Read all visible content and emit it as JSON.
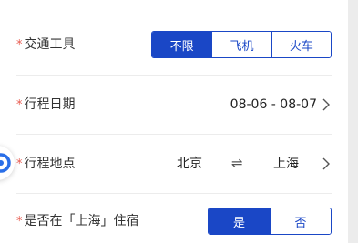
{
  "transport": {
    "label": "交通工具",
    "required_mark": "*",
    "options": [
      "不限",
      "飞机",
      "火车"
    ],
    "selected": "不限"
  },
  "dates": {
    "label": "行程日期",
    "required_mark": "*",
    "value": "08-06 - 08-07"
  },
  "places": {
    "label": "行程地点",
    "required_mark": "*",
    "from": "北京",
    "swap_symbol": "⇌",
    "to": "上海"
  },
  "stay": {
    "label": "是否在「上海」住宿",
    "required_mark": "*",
    "options": [
      "是",
      "否"
    ],
    "selected": "是"
  },
  "colors": {
    "accent": "#1a47c6",
    "required": "#e85a4f"
  },
  "icons": {
    "chevron": "chevron-right-icon",
    "swap": "swap-arrows-icon",
    "floating_badge": "assistant-badge-icon"
  }
}
